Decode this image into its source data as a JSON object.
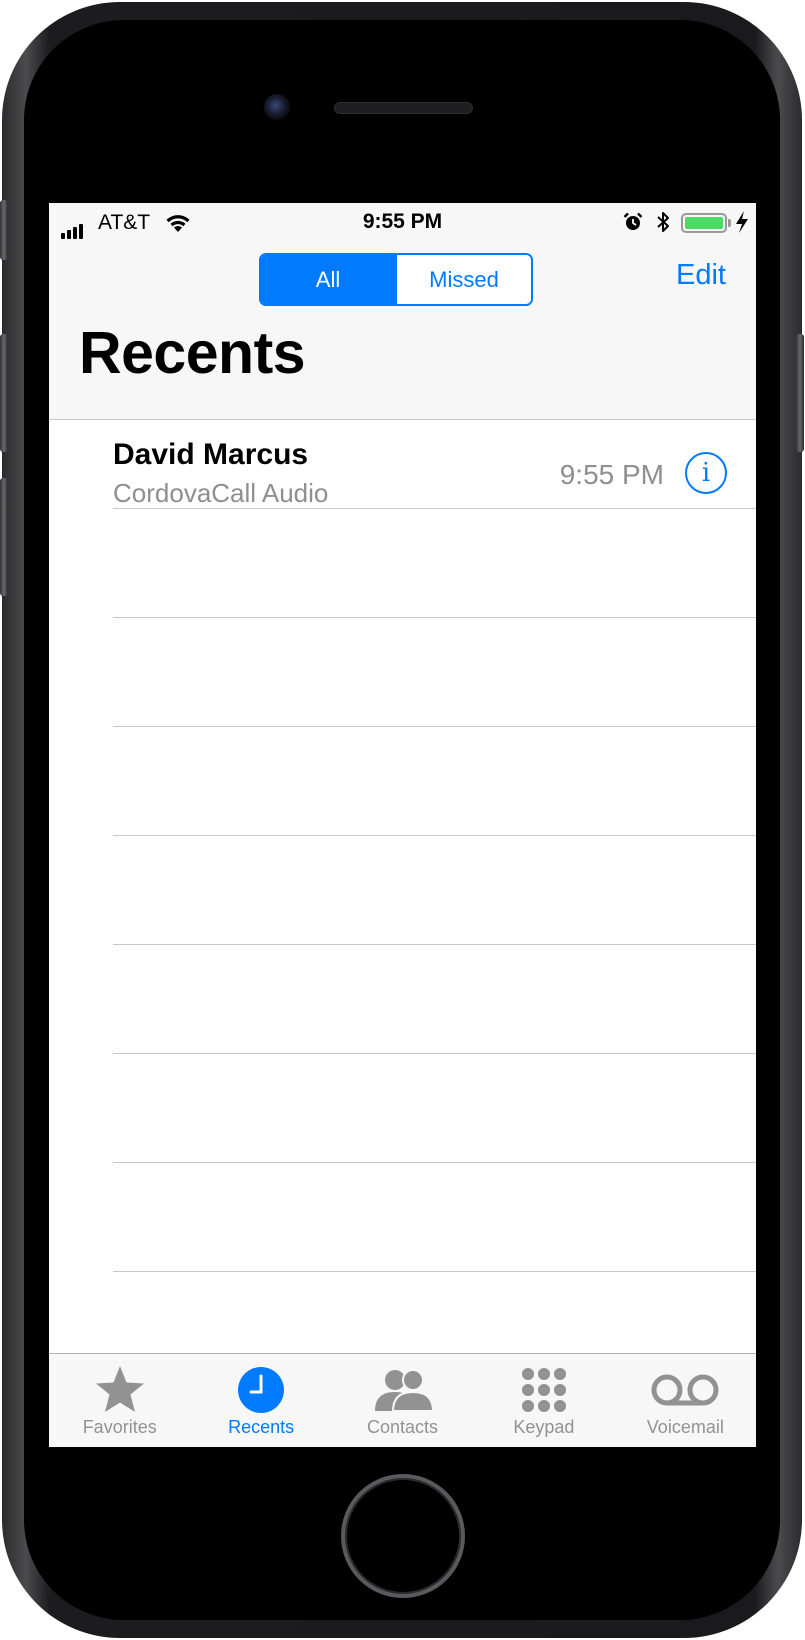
{
  "status_bar": {
    "carrier": "AT&T",
    "time": "9:55 PM",
    "battery_level": 1.0
  },
  "nav": {
    "segments": [
      "All",
      "Missed"
    ],
    "selected_segment": "All",
    "edit_label": "Edit",
    "title": "Recents"
  },
  "calls": [
    {
      "name": "David Marcus",
      "type": "CordovaCall Audio",
      "time": "9:55 PM",
      "info_label": "i"
    }
  ],
  "tab_bar": {
    "items": [
      {
        "label": "Favorites",
        "icon": "star-icon"
      },
      {
        "label": "Recents",
        "icon": "clock-icon"
      },
      {
        "label": "Contacts",
        "icon": "contacts-icon"
      },
      {
        "label": "Keypad",
        "icon": "keypad-icon"
      },
      {
        "label": "Voicemail",
        "icon": "voicemail-icon"
      }
    ],
    "selected": "Recents"
  },
  "colors": {
    "accent": "#007aff",
    "secondary_text": "#8e8e93",
    "tab_inactive": "#929292",
    "battery": "#4cd964"
  }
}
